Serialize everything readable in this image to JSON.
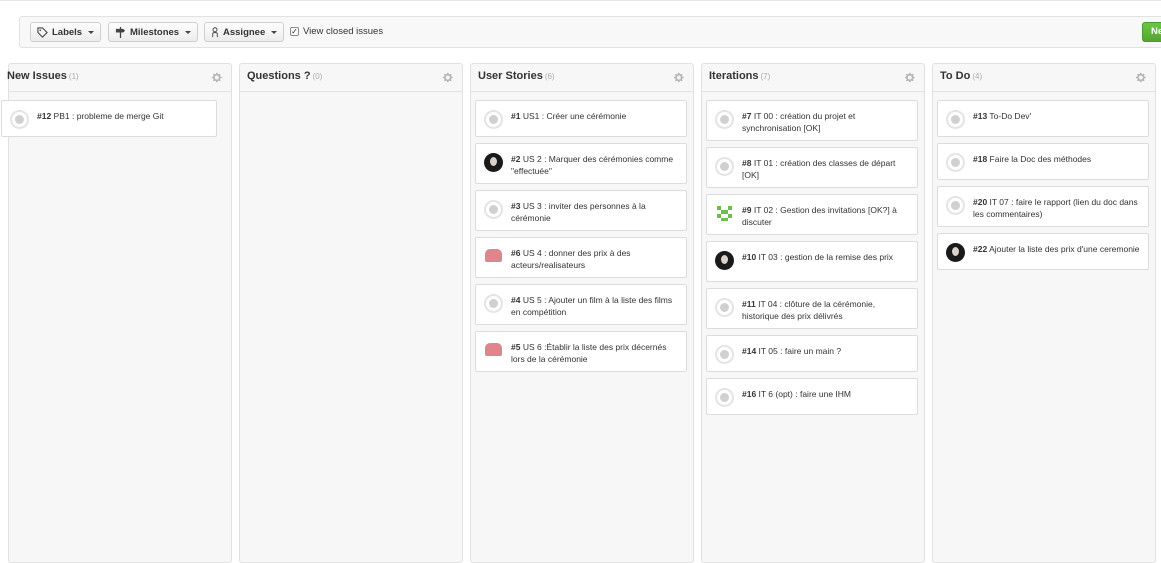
{
  "toolbar": {
    "labels_label": "Labels",
    "milestones_label": "Milestones",
    "assignee_label": "Assignee",
    "view_closed_label": "View closed issues",
    "new_label": "Ne"
  },
  "columns": [
    {
      "title": "New Issues",
      "count": "(1)",
      "cards": [
        {
          "num": "#12",
          "text": " PB1 : probleme de merge Git",
          "avatar": "default"
        }
      ]
    },
    {
      "title": "Questions ?",
      "count": "(0)",
      "cards": []
    },
    {
      "title": "User Stories",
      "count": "(6)",
      "cards": [
        {
          "num": "#1",
          "text": " US1 : Créer une cérémonie",
          "avatar": "default"
        },
        {
          "num": "#2",
          "text": " US 2 : Marquer des cérémonies comme \"effectuée\"",
          "avatar": "dark"
        },
        {
          "num": "#3",
          "text": " US 3 : inviter des personnes à la cérémonie",
          "avatar": "default"
        },
        {
          "num": "#6",
          "text": " US 4 : donner des prix à des acteurs/realisateurs",
          "avatar": "pink"
        },
        {
          "num": "#4",
          "text": " US 5 : Ajouter un film à la liste des films en compétition",
          "avatar": "default"
        },
        {
          "num": "#5",
          "text": " US 6 :Établir la liste des prix décernés lors de la cérémonie",
          "avatar": "pink"
        }
      ]
    },
    {
      "title": "Iterations",
      "count": "(7)",
      "cards": [
        {
          "num": "#7",
          "text": " IT 00 : création du projet et synchronisation [OK]",
          "avatar": "default"
        },
        {
          "num": "#8",
          "text": " IT 01 : création des classes de départ [OK]",
          "avatar": "default"
        },
        {
          "num": "#9",
          "text": " IT 02 : Gestion des invitations [OK?] à discuter",
          "avatar": "green"
        },
        {
          "num": "#10",
          "text": " IT 03 : gestion de la remise des prix",
          "avatar": "dark"
        },
        {
          "num": "#11",
          "text": " IT 04 : clôture de la cérémonie, historique des prix délivrés",
          "avatar": "default"
        },
        {
          "num": "#14",
          "text": " IT 05 : faire un main ?",
          "avatar": "default"
        },
        {
          "num": "#16",
          "text": " IT 6 (opt) : faire une IHM",
          "avatar": "default"
        }
      ]
    },
    {
      "title": "To Do",
      "count": "(4)",
      "cards": [
        {
          "num": "#13",
          "text": " To-Do Dev'",
          "avatar": "default"
        },
        {
          "num": "#18",
          "text": " Faire la Doc des méthodes",
          "avatar": "default"
        },
        {
          "num": "#20",
          "text": " IT 07 : faire le rapport (lien du doc dans les commentaires)",
          "avatar": "default"
        },
        {
          "num": "#22",
          "text": " Ajouter la liste des prix d'une ceremonie",
          "avatar": "dark"
        }
      ]
    }
  ]
}
